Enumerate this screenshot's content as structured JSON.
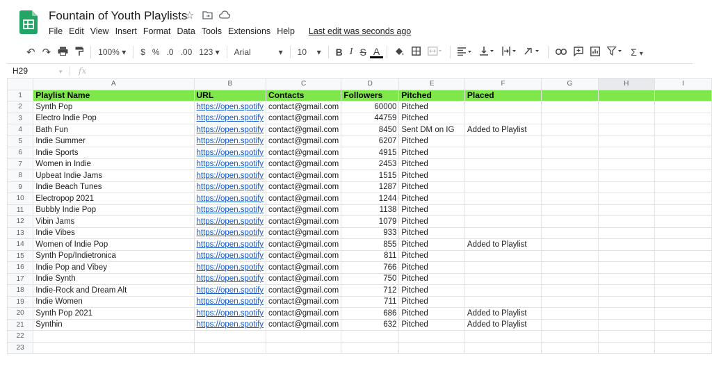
{
  "app": {
    "doc_title": "Fountain of Youth Playlists",
    "last_edit": "Last edit was seconds ago",
    "menu": [
      "File",
      "Edit",
      "View",
      "Insert",
      "Format",
      "Data",
      "Tools",
      "Extensions",
      "Help"
    ]
  },
  "toolbar": {
    "zoom": "100%",
    "currency": "$",
    "percent": "%",
    "decimal_decrease": ".0",
    "decimal_increase": ".00",
    "number_format": "123",
    "font": "Arial",
    "font_size": "10",
    "bold": "B",
    "italic": "I",
    "strike": "S",
    "text_color": "A"
  },
  "formula_bar": {
    "cell_ref": "H29",
    "fx": "fx"
  },
  "columns": [
    "A",
    "B",
    "C",
    "D",
    "E",
    "F",
    "G",
    "H",
    "I"
  ],
  "selected_column": "H",
  "header_row": [
    "Playlist Name",
    "URL",
    "Contacts",
    "Followers",
    "Pitched",
    "Placed"
  ],
  "rows": [
    [
      "Synth Pop",
      "https://open.spotify",
      "contact@gmail.com",
      "60000",
      "Pitched",
      ""
    ],
    [
      "Electro Indie Pop",
      "https://open.spotify",
      "contact@gmail.com",
      "44759",
      "Pitched",
      ""
    ],
    [
      "Bath Fun",
      "https://open.spotify",
      "contact@gmail.com",
      "8450",
      "Sent DM on IG",
      "Added to Playlist"
    ],
    [
      "Indie Summer",
      "https://open.spotify",
      "contact@gmail.com",
      "6207",
      "Pitched",
      ""
    ],
    [
      "Indie Sports",
      "https://open.spotify",
      "contact@gmail.com",
      "4915",
      "Pitched",
      ""
    ],
    [
      "Women in Indie",
      "https://open.spotify",
      "contact@gmail.com",
      "2453",
      "Pitched",
      ""
    ],
    [
      "Upbeat Indie Jams",
      "https://open.spotify",
      "contact@gmail.com",
      "1515",
      "Pitched",
      ""
    ],
    [
      "Indie Beach Tunes",
      "https://open.spotify",
      "contact@gmail.com",
      "1287",
      "Pitched",
      ""
    ],
    [
      "Electropop 2021",
      "https://open.spotify",
      "contact@gmail.com",
      "1244",
      "Pitched",
      ""
    ],
    [
      "Bubbly Indie Pop",
      "https://open.spotify",
      "contact@gmail.com",
      "1138",
      "Pitched",
      ""
    ],
    [
      "Vibin Jams",
      "https://open.spotify",
      "contact@gmail.com",
      "1079",
      "Pitched",
      ""
    ],
    [
      "Indie Vibes",
      "https://open.spotify",
      "contact@gmail.com",
      "933",
      "Pitched",
      ""
    ],
    [
      "Women of Indie Pop",
      "https://open.spotify",
      "contact@gmail.com",
      "855",
      "Pitched",
      "Added to Playlist"
    ],
    [
      "Synth Pop/Indietronica",
      "https://open.spotify",
      "contact@gmail.com",
      "811",
      "Pitched",
      ""
    ],
    [
      "Indie Pop and Vibey",
      "https://open.spotify",
      "contact@gmail.com",
      "766",
      "Pitched",
      ""
    ],
    [
      "Indie Synth",
      "https://open.spotify",
      "contact@gmail.com",
      "750",
      "Pitched",
      ""
    ],
    [
      "Indie-Rock and Dream Alt",
      "https://open.spotify",
      "contact@gmail.com",
      "712",
      "Pitched",
      ""
    ],
    [
      "Indie Women",
      "https://open.spotify",
      "contact@gmail.com",
      "711",
      "Pitched",
      ""
    ],
    [
      "Synth Pop 2021",
      "https://open.spotify",
      "contact@gmail.com",
      "686",
      "Pitched",
      "Added to Playlist"
    ],
    [
      "Synthin",
      "https://open.spotify",
      "contact@gmail.com",
      "632",
      "Pitched",
      "Added to Playlist"
    ]
  ],
  "empty_rows": [
    "22",
    "23"
  ],
  "colors": {
    "header_fill": "#7ee749",
    "link": "#1155cc",
    "sheets_green": "#23a566"
  }
}
